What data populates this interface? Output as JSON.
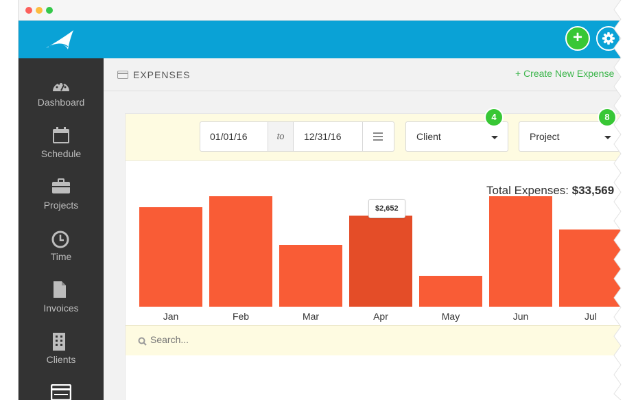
{
  "window": {
    "controls": [
      {
        "name": "close",
        "color": "#fc605c"
      },
      {
        "name": "minimize",
        "color": "#fdbc40"
      },
      {
        "name": "maximize",
        "color": "#34c84a"
      }
    ]
  },
  "topbar": {
    "logo_icon": "feather-logo-icon",
    "add_icon": "plus-icon",
    "add_label": "+",
    "settings_icon": "gear-icon"
  },
  "sidebar": {
    "items": [
      {
        "label": "Dashboard",
        "icon": "gauge-icon"
      },
      {
        "label": "Schedule",
        "icon": "calendar-icon"
      },
      {
        "label": "Projects",
        "icon": "briefcase-icon"
      },
      {
        "label": "Time",
        "icon": "clock-icon"
      },
      {
        "label": "Invoices",
        "icon": "document-icon"
      },
      {
        "label": "Clients",
        "icon": "building-icon"
      },
      {
        "label": "",
        "icon": "expenses-icon"
      }
    ]
  },
  "subheader": {
    "icon": "credit-card-icon",
    "title": "EXPENSES",
    "create_label": "+ Create New Expense"
  },
  "filters": {
    "date_from": "01/01/16",
    "date_sep": "to",
    "date_to": "12/31/16",
    "date_menu_icon": "list-icon",
    "client": {
      "label": "Client",
      "badge": "4"
    },
    "project": {
      "label": "Project",
      "badge": "8"
    }
  },
  "summary": {
    "total_label": "Total Expenses:",
    "total_value": "$33,569"
  },
  "tooltip": {
    "label": "$2,652",
    "month": "Apr"
  },
  "colors": {
    "bar": "#f95c36",
    "bar_highlight": "#e44d28",
    "brand": "#0aa2d6",
    "accent": "#38c735"
  },
  "chart_data": {
    "type": "bar",
    "categories": [
      "Jan",
      "Feb",
      "Mar",
      "Apr",
      "May",
      "Jun",
      "Jul"
    ],
    "values": [
      2900,
      3600,
      1800,
      2652,
      900,
      3300,
      2250
    ],
    "highlighted": "Apr",
    "ylim": [
      0,
      4000
    ]
  },
  "search": {
    "placeholder": "Search...",
    "icon": "search-icon"
  }
}
